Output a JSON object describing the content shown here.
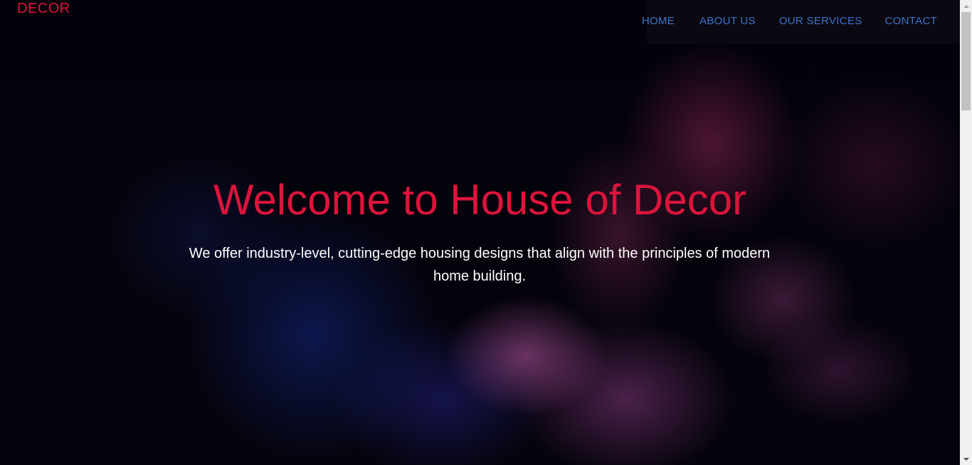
{
  "header": {
    "logo": "DECOR",
    "nav": [
      {
        "label": "HOME"
      },
      {
        "label": "ABOUT US"
      },
      {
        "label": "OUR SERVICES"
      },
      {
        "label": "CONTACT"
      }
    ]
  },
  "hero": {
    "title": "Welcome to House of Decor",
    "description": "We offer industry-level, cutting-edge housing designs that align with the principles of modern home building."
  },
  "colors": {
    "accent": "#dc143c",
    "nav_link": "#3a74c9",
    "text": "#ffffff",
    "background": "#000000"
  },
  "icons": {
    "scroll_up": "chevron-up-icon",
    "scroll_down": "chevron-down-icon"
  },
  "scroll": {
    "position": 0
  }
}
